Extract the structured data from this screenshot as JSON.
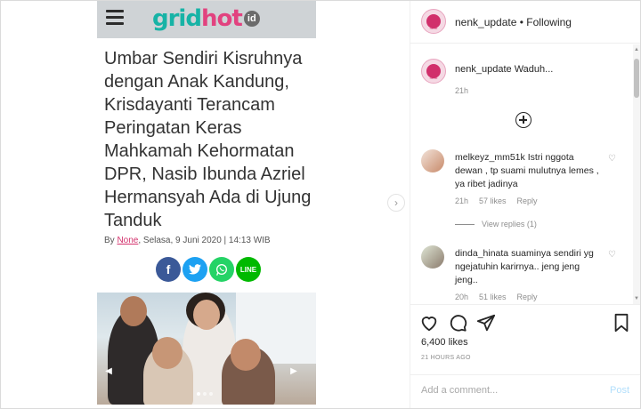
{
  "article": {
    "logo_prefix": "grid",
    "logo_hot": "hot",
    "logo_tld": "id",
    "headline": "Umbar Sendiri Kisruhnya dengan Anak Kandung, Krisdayanti Terancam Peringatan Keras Mahkamah Kehormatan DPR, Nasib Ibunda Azriel Hermansyah Ada di Ujung Tanduk",
    "byline_prefix": "By ",
    "author": "None",
    "byline_suffix": ", Selasa, 9 Juni 2020 | 14:13 WIB",
    "share": {
      "facebook": "f",
      "twitter": "t",
      "whatsapp": "w",
      "line": "LINE"
    }
  },
  "post": {
    "username": "nenk_update",
    "follow_status": "Following",
    "separator": " • ",
    "caption_text": "Waduh...",
    "caption_time": "21h",
    "likes": "6,400 likes",
    "time_ago": "21 HOURS AGO"
  },
  "comments": [
    {
      "user": "melkeyz_mm51k",
      "text": "Istri nggota dewan , tp suami mulutnya lemes , ya ribet jadinya",
      "time": "21h",
      "likes": "57 likes",
      "reply": "Reply",
      "view_replies": "View replies (1)"
    },
    {
      "user": "dinda_hinata",
      "text": "suaminya sendiri yg ngejatuhin karirnya.. jeng jeng jeng..",
      "time": "20h",
      "likes": "51 likes",
      "reply": "Reply"
    }
  ],
  "composer": {
    "placeholder": "Add a comment...",
    "post_label": "Post"
  },
  "icons": {
    "menu": "hamburger-icon",
    "next": "chevron-right-icon",
    "like": "heart-icon",
    "comment": "comment-icon",
    "share": "paper-plane-icon",
    "save": "bookmark-icon",
    "load_more": "plus-circle-icon"
  },
  "colors": {
    "logo_grid": "#17b3a6",
    "logo_hot": "#e2427f",
    "facebook": "#3b5998",
    "twitter": "#1da1f2",
    "whatsapp": "#25d366",
    "line": "#00b900",
    "post_button": "#b2dffc"
  }
}
